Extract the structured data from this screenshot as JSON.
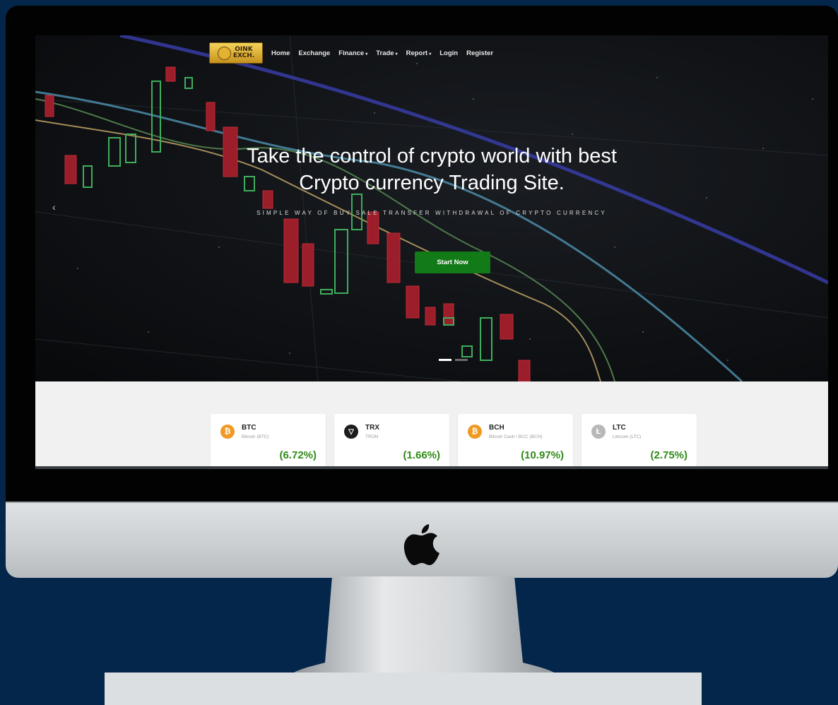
{
  "nav": {
    "logo_text": "OINK EXCHANGE",
    "items": [
      {
        "label": "Home"
      },
      {
        "label": "Exchange"
      },
      {
        "label": "Finance",
        "caret": "▾"
      },
      {
        "label": "Trade",
        "caret": "▾"
      },
      {
        "label": "Report",
        "caret": "▾"
      },
      {
        "label": "Login"
      },
      {
        "label": "Register"
      }
    ]
  },
  "hero": {
    "headline_line1": "Take the control of crypto world with best",
    "headline_line2": "Crypto currency Trading Site.",
    "subline": "SIMPLE WAY OF BUY SALE TRANSFER WITHDRAWAL OF CRYPTO CURRENCY",
    "cta_label": "Start Now",
    "prev_arrow": "‹",
    "slides_total": 2,
    "active_slide": 1
  },
  "tickers": [
    {
      "symbol": "BTC",
      "name": "Bitcoin (BTC)",
      "change": "(6.72%)",
      "icon": "bitcoin-icon",
      "icon_glyph": "₿",
      "color": "#f09a25"
    },
    {
      "symbol": "TRX",
      "name": "TRON",
      "change": "(1.66%)",
      "icon": "tron-icon",
      "icon_glyph": "▽",
      "color": "#1c1c1c"
    },
    {
      "symbol": "BCH",
      "name": "Bitcoin Cash / BCC (BCH)",
      "change": "(10.97%)",
      "icon": "bitcoin-cash-icon",
      "icon_glyph": "₿",
      "color": "#f09a25"
    },
    {
      "symbol": "LTC",
      "name": "Litecoin (LTC)",
      "change": "(2.75%)",
      "icon": "litecoin-icon",
      "icon_glyph": "Ł",
      "color": "#b8b8b8"
    }
  ],
  "colors": {
    "background": "#03264a",
    "cta": "#137a18",
    "positive": "#2e8b17"
  }
}
